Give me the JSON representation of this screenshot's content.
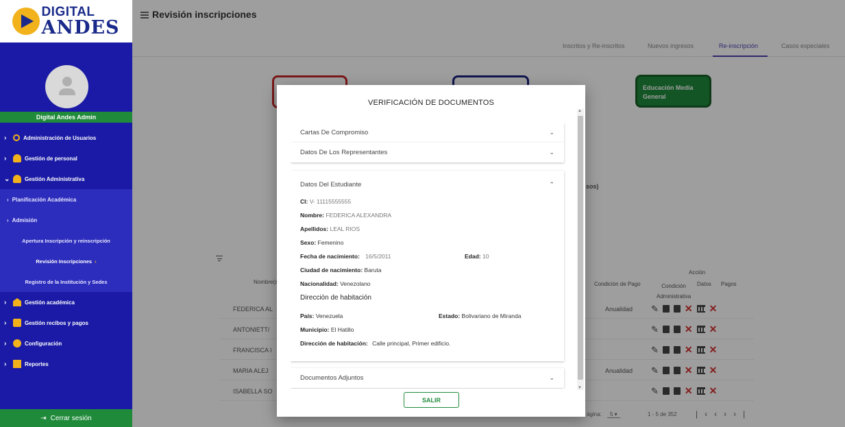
{
  "sidebar": {
    "logo_line1": "DIGITAL",
    "logo_line2": "ANDES",
    "admin_name": "Digital Andes Admin",
    "items": [
      {
        "label": "Administración de Usuarios"
      },
      {
        "label": "Gestión de personal"
      },
      {
        "label": "Gestión Administrativa"
      }
    ],
    "subitems": [
      {
        "label": "Planificación Académica"
      },
      {
        "label": "Admisión"
      }
    ],
    "subsubitems": [
      {
        "label": "Apertura Inscripción y reinscripción"
      },
      {
        "label": "Revisión Inscripciones"
      },
      {
        "label": "Registro de la Institución y Sedes"
      }
    ],
    "items2": [
      {
        "label": "Gestión académica"
      },
      {
        "label": "Gestión recibos y pagos"
      },
      {
        "label": "Configuración"
      },
      {
        "label": "Reportes"
      }
    ],
    "logout": "Cerrar sesión"
  },
  "header": {
    "title": "Revisión inscripciones"
  },
  "tabs": [
    {
      "label": "Inscritos y Re-inscritos"
    },
    {
      "label": "Nuevos ingresos"
    },
    {
      "label": "Re-inscripción"
    },
    {
      "label": "Casos especiales"
    }
  ],
  "cards": {
    "green": "Educación Media General"
  },
  "background_table": {
    "partial_heading": "sos)",
    "col_nombre": "Nombre(s",
    "col_condicion_pago": "Condición de Pago",
    "col_accion": "Acción",
    "col_condicion_adm": "Condición Administrativa",
    "col_datos": "Datos",
    "col_pagos": "Pagos",
    "rows": [
      {
        "name": "FEDERICA AL",
        "pago": "Anualidad"
      },
      {
        "name": "ANTONIETT/",
        "pago": ""
      },
      {
        "name": "FRANCISCA I",
        "pago": ""
      },
      {
        "name": "MARIA ALEJ",
        "pago": "Anualidad"
      },
      {
        "name": "ISABELLA SO",
        "pago": ""
      }
    ],
    "pager_label": "ágina:",
    "pager_size": "5",
    "pager_range": "1 - 5 de 352"
  },
  "modal": {
    "title": "VERIFICACIÓN DE DOCUMENTOS",
    "panels": {
      "cartas": "Cartas De Compromiso",
      "representantes": "Datos De Los Representantes",
      "estudiante": "Datos Del Estudiante",
      "adjuntos": "Documentos Adjuntos"
    },
    "student": {
      "ci_label": "CI:",
      "ci_value": "V- 11115555555",
      "nombre_label": "Nombre:",
      "nombre_value": "FEDERICA ALEXANDRA",
      "apellidos_label": "Apellidos:",
      "apellidos_value": "LEAL RIOS",
      "sexo_label": "Sexo:",
      "sexo_value": "Femenino",
      "fecha_label": "Fecha de nacimiento:",
      "fecha_value": "16/5/2011",
      "edad_label": "Edad:",
      "edad_value": "10",
      "ciudad_label": "Ciudad de nacimiento:",
      "ciudad_value": "Baruta",
      "nacionalidad_label": "Nacionalidad:",
      "nacionalidad_value": "Venezolano",
      "direccion_title": "Dirección de habitación",
      "pais_label": "País:",
      "pais_value": "Venezuela",
      "estado_label": "Estado:",
      "estado_value": "Bolivariano de Miranda",
      "municipio_label": "Municipio:",
      "municipio_value": "El Hatillo",
      "direccion_label": "Dirección de habitación:",
      "direccion_value": "Calle principal, Primer edificio."
    },
    "exit_button": "SALIR"
  }
}
